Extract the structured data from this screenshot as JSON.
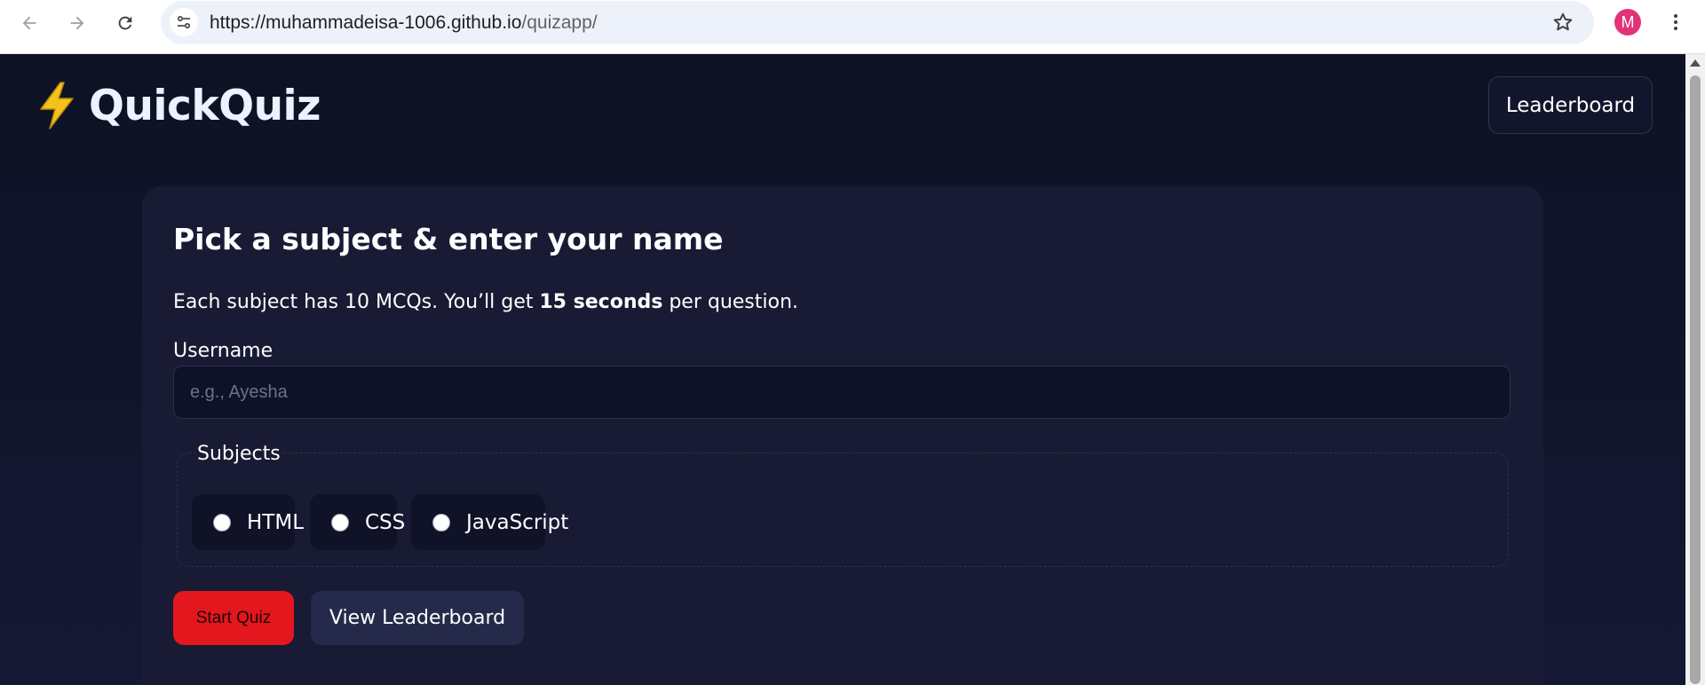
{
  "browser": {
    "url_host": "https://muhammadeisa-1006.github.io",
    "url_path": "/quizapp/",
    "profile_initial": "M",
    "icons": [
      "back-arrow-icon",
      "forward-arrow-icon",
      "reload-icon",
      "site-info-icon",
      "star-icon",
      "more-vert-icon"
    ]
  },
  "header": {
    "brand_icon": "lightning-bolt-icon",
    "brand_name": "QuickQuiz",
    "leaderboard_label": "Leaderboard"
  },
  "card": {
    "title": "Pick a subject & enter your name",
    "desc_prefix": "Each subject has 10 MCQs. You’ll get ",
    "desc_bold": "15 seconds",
    "desc_suffix": " per question.",
    "username_label": "Username",
    "username_placeholder": "e.g., Ayesha",
    "username_value": "",
    "subjects_legend": "Subjects",
    "subjects": [
      {
        "label": "HTML",
        "checked": false
      },
      {
        "label": "CSS",
        "checked": false
      },
      {
        "label": "JavaScript",
        "checked": false
      }
    ],
    "start_label": "Start Quiz",
    "view_label": "View Leaderboard"
  },
  "colors": {
    "page_bg": "#12152a",
    "card_bg": "#181b33",
    "start_button": "#e3171d",
    "secondary_button": "#262a4a",
    "avatar": "#e2337a",
    "bolt": "#f5c21b"
  }
}
